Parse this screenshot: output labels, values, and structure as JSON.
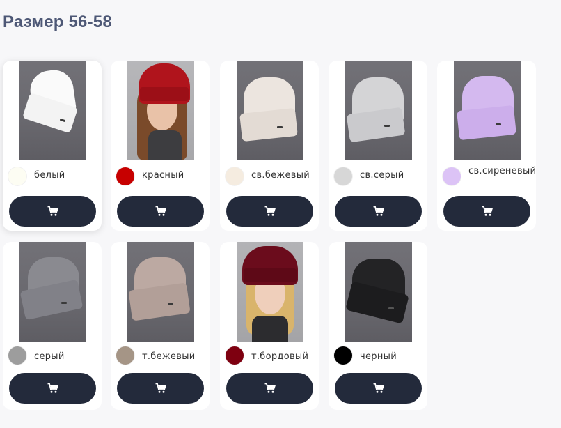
{
  "page": {
    "title": "Размер 56-58"
  },
  "icons": {
    "cart": "shopping-cart-icon"
  },
  "products": [
    {
      "color_name": "белый",
      "swatch": "#fdfdf3",
      "photo": "hat-white"
    },
    {
      "color_name": "красный",
      "swatch": "#c70000",
      "photo": "model-red"
    },
    {
      "color_name": "св.бежевый",
      "swatch": "#f5ece0",
      "photo": "hat-light-beige"
    },
    {
      "color_name": "св.серый",
      "swatch": "#d7d7d7",
      "photo": "hat-light-grey"
    },
    {
      "color_name": "св.сиреневый",
      "swatch": "#dcc3f6",
      "photo": "hat-lilac"
    },
    {
      "color_name": "серый",
      "swatch": "#9d9d9d",
      "photo": "hat-grey"
    },
    {
      "color_name": "т.бежевый",
      "swatch": "#a59586",
      "photo": "hat-dark-beige"
    },
    {
      "color_name": "т.бордовый",
      "swatch": "#7e0010",
      "photo": "model-burgundy"
    },
    {
      "color_name": "черный",
      "swatch": "#000000",
      "photo": "hat-black"
    }
  ]
}
